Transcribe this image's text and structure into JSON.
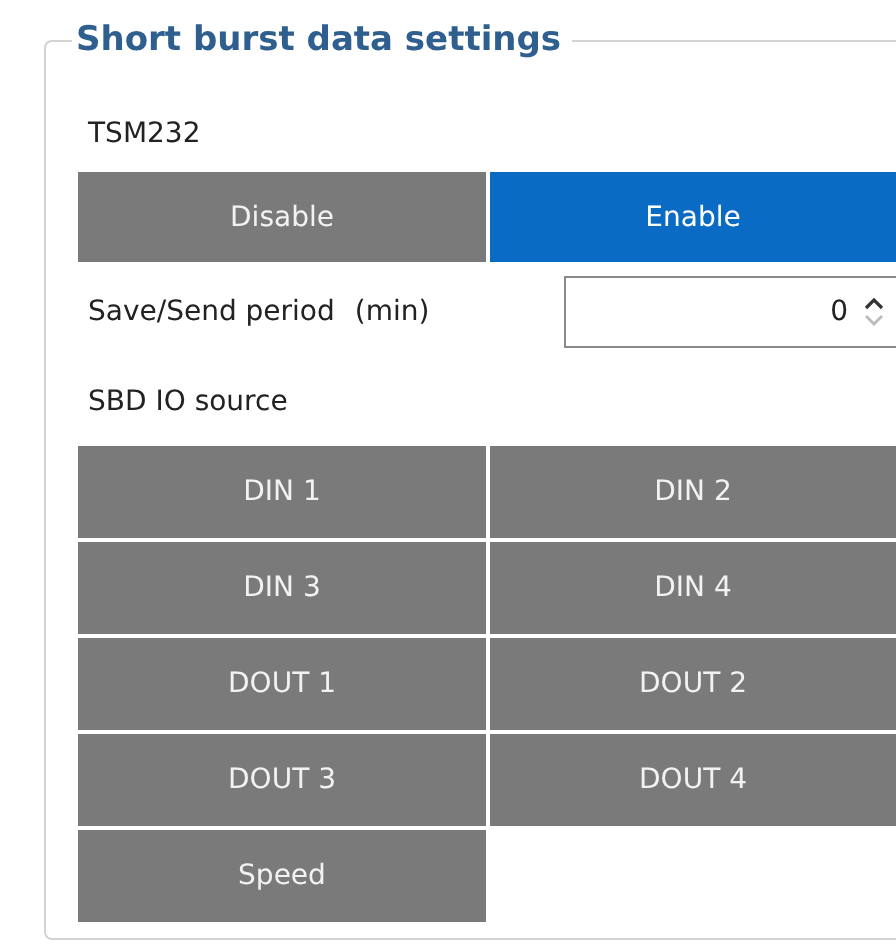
{
  "group": {
    "title": "Short burst data settings"
  },
  "tsm232": {
    "label": "TSM232",
    "options": [
      {
        "label": "Disable",
        "selected": false
      },
      {
        "label": "Enable",
        "selected": true
      }
    ]
  },
  "period": {
    "label": "Save/Send period",
    "unit": "(min)",
    "value": "0"
  },
  "io_source": {
    "label": "SBD IO source",
    "options": [
      {
        "label": "DIN 1",
        "selected": false
      },
      {
        "label": "DIN 2",
        "selected": false
      },
      {
        "label": "DIN 3",
        "selected": false
      },
      {
        "label": "DIN 4",
        "selected": false
      },
      {
        "label": "DOUT 1",
        "selected": false
      },
      {
        "label": "DOUT 2",
        "selected": false
      },
      {
        "label": "DOUT 3",
        "selected": false
      },
      {
        "label": "DOUT 4",
        "selected": false
      },
      {
        "label": "Speed",
        "selected": false
      }
    ]
  }
}
